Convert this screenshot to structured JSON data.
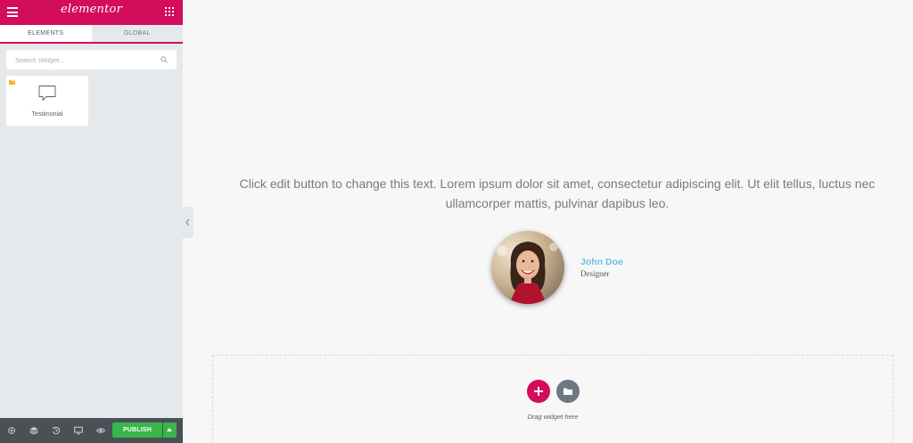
{
  "panel": {
    "logo": "elementor",
    "tabs": [
      {
        "label": "ELEMENTS"
      },
      {
        "label": "GLOBAL"
      }
    ],
    "search": {
      "placeholder": "Search Widget..."
    },
    "widget": {
      "label": "Testimonial",
      "icon": "testimonial-icon"
    },
    "footer": {
      "icons": [
        "gear-icon",
        "layers-icon",
        "history-icon",
        "desktop-icon",
        "eye-icon"
      ],
      "publish_label": "PUBLISH"
    }
  },
  "canvas": {
    "testimonial": {
      "text": "Click edit button to change this text. Lorem ipsum dolor sit amet, consectetur adipiscing elit. Ut elit tellus, luctus nec ullamcorper mattis, pulvinar dapibus leo.",
      "name": "John Doe",
      "job": "Designer"
    },
    "drop_zone": {
      "label": "Drag widget here"
    }
  },
  "colors": {
    "brand": "#d30c5c",
    "publish": "#39b54a",
    "name": "#6ec1e4",
    "panel_bg": "#e6e9ec",
    "footer_bg": "#495157"
  }
}
